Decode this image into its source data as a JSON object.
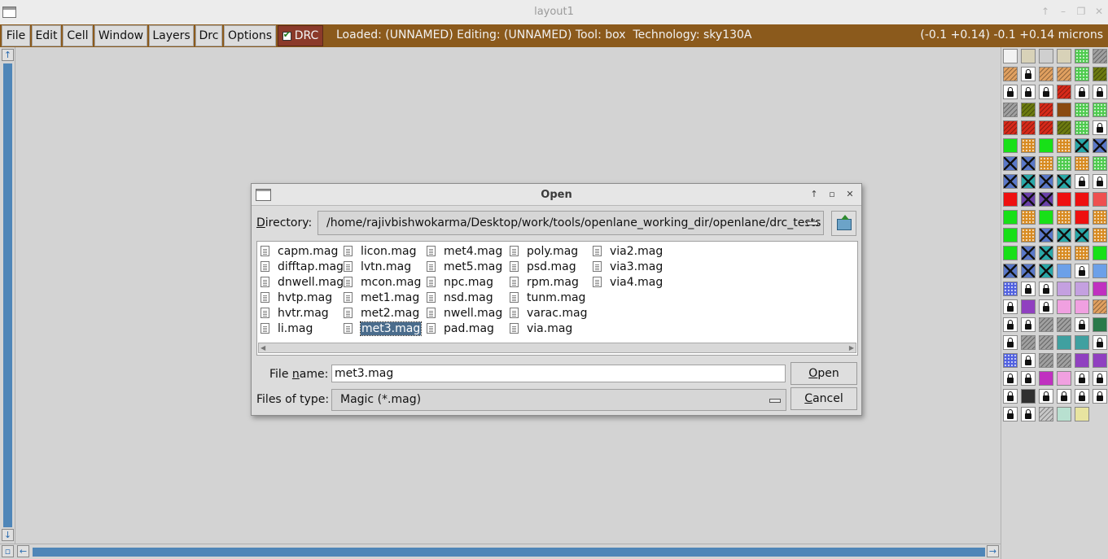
{
  "window": {
    "title": "layout1"
  },
  "menu": {
    "items": [
      "File",
      "Edit",
      "Cell",
      "Window",
      "Layers",
      "Drc",
      "Options"
    ],
    "drc_label": "DRC"
  },
  "status": {
    "text": "Loaded: (UNNAMED) Editing: (UNNAMED) Tool: box  Technology: sky130A",
    "coords": "(-0.1 +0.14) -0.1 +0.14 microns"
  },
  "dialog": {
    "title": "Open",
    "directory_label": "Directory:",
    "directory_value": "/home/rajivbishwokarma/Desktop/work/tools/openlane_working_dir/openlane/drc_tests",
    "files": [
      [
        "capm.mag",
        "difftap.mag",
        "dnwell.mag",
        "hvtp.mag",
        "hvtr.mag",
        "li.mag"
      ],
      [
        "licon.mag",
        "lvtn.mag",
        "mcon.mag",
        "met1.mag",
        "met2.mag",
        "met3.mag"
      ],
      [
        "met4.mag",
        "met5.mag",
        "npc.mag",
        "nsd.mag",
        "nwell.mag",
        "pad.mag"
      ],
      [
        "poly.mag",
        "psd.mag",
        "rpm.mag",
        "tunm.mag",
        "varac.mag",
        "via.mag"
      ],
      [
        "via2.mag",
        "via3.mag",
        "via4.mag"
      ]
    ],
    "selected_file": "met3.mag",
    "file_name_label": "File name:",
    "file_name_value": "met3.mag",
    "file_type_label": "Files of type:",
    "file_type_value": "Magic (*.mag)",
    "open_label": "Open",
    "cancel_label": "Cancel"
  },
  "colors": {
    "menubar": "#8b5a1c",
    "drc_toggle": "#8b3a2a",
    "scrollbar": "#4f86b8",
    "selection": "#4a6c8c"
  }
}
